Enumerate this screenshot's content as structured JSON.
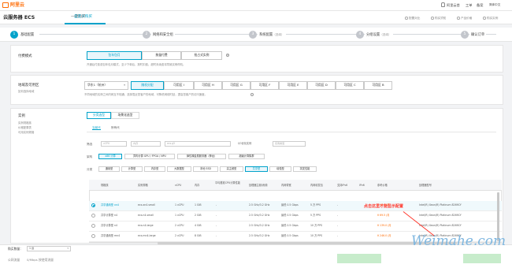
{
  "topbar": {
    "logo_text": "阿里云",
    "home": "阿里云首",
    "work": "工单",
    "filing": "备案",
    "support": "支持与服务",
    "lang": "简体中文"
  },
  "subbar": {
    "product_title": "云服务器 ECS",
    "tabs": [
      "一键购买",
      "自定义购买"
    ],
    "links": [
      "配置对比",
      "购买须知",
      "产品价格",
      "购买实例"
    ]
  },
  "steps": [
    {
      "num": "1",
      "label": "基础配置",
      "note": ""
    },
    {
      "num": "2",
      "label": "网络和安全组",
      "note": ""
    },
    {
      "num": "3",
      "label": "系统配置",
      "note": "（选填）"
    },
    {
      "num": "4",
      "label": "分组设置",
      "note": "（选填）"
    },
    {
      "num": "5",
      "label": "确认订单",
      "note": ""
    }
  ],
  "billing": {
    "title": "付费模式",
    "options": [
      "包年包月",
      "按量付费",
      "抢占式实例"
    ],
    "hint": "?",
    "desc": "开通后付费或包年包月模式，至少下单后，按时扣费。超时未续费将导致实例停机。"
  },
  "region": {
    "title": "地域及可用区",
    "desc": "如何选择地域",
    "region_select": "华东1（杭州）",
    "zones": [
      "随机分配",
      "可用区 I",
      "可用区 H",
      "可用区 G",
      "可用区 F",
      "可用区 E",
      "可用区 D",
      "可用区 C",
      "可用区 B"
    ],
    "note": "不同地域的实例之间内网互不相通，选择靠近您客户的地域，可降低网络时延，提高您客户的访问速度。"
  },
  "instance": {
    "title": "实例",
    "links": [
      "实例规格族",
      "价格配置表",
      "可用实例规格"
    ],
    "tabs": [
      "分类选型",
      "场景化选型"
    ],
    "subtabs": [
      "当前代",
      "所有代"
    ],
    "filter_label": "筛选",
    "filters": [
      "vCPU",
      "内存",
      "ecs.g5",
      "I/O优化实例",
      "实例类型"
    ],
    "arch_label": "架构",
    "arch": [
      "x86 计算",
      "异构计算 GPU / FPGA / NPU",
      "弹性裸金属服务器（神龙）",
      "超级计算集群"
    ],
    "cat_label": "分类",
    "categories": [
      "通用型",
      "计算型",
      "内存型",
      "大数据型",
      "本地 SSD",
      "高主频型",
      "共享型",
      "增强型",
      "突发性能"
    ],
    "headers": [
      "规格族",
      "实例规格",
      "vCPU",
      "内存",
      "平均基准CPU计算性能",
      "处理器主频/睿频",
      "内网带宽",
      "内网收发包",
      "支持IPv6",
      "IPv6",
      "参考价格",
      "处理器型号"
    ],
    "rows": [
      {
        "family": "共享通用型 xn4",
        "spec": "ecs.xn4.small",
        "vcpu": "1 vCPU",
        "mem": "1 GiB",
        "base": "-",
        "freq": "2.5 GHz/3.2 GHz",
        "bw": "最低 0.5 Gbps",
        "pps": "5 万 PPS",
        "v6": "-",
        "price": "¥ 46.8 /月",
        "cpu": "Intel(R) Xeon(R) Platinum 8269CY",
        "selected": true
      },
      {
        "family": "共享计算型 n4",
        "spec": "ecs.n4.small",
        "vcpu": "1 vCPU",
        "mem": "2 GiB",
        "base": "-",
        "freq": "2.5 GHz/3.2 GHz",
        "bw": "最低 0.5 Gbps",
        "pps": "5 万 PPS",
        "v6": "-",
        "price": "¥ 69.5 /月",
        "cpu": "Intel(R) Xeon(R) Platinum 8269CY",
        "selected": false
      },
      {
        "family": "共享计算型 n4",
        "spec": "ecs.n4.large",
        "vcpu": "2 vCPU",
        "mem": "4 GiB",
        "base": "-",
        "freq": "2.5 GHz/3.2 GHz",
        "bw": "最低 0.5 Gbps",
        "pps": "10 万 PPS",
        "v6": "-",
        "price": "¥ 139.0 /月",
        "cpu": "Intel(R) Xeon(R) Platinum 8269CY",
        "selected": false
      },
      {
        "family": "共享通用型 mn4",
        "spec": "ecs.mn4.large",
        "vcpu": "2 vCPU",
        "mem": "8 GiB",
        "base": "-",
        "freq": "2.5 GHz/3.2 GHz",
        "bw": "最低 0.5 Gbps",
        "pps": "10 万 PPS",
        "v6": "-",
        "price": "¥ 246.0 /月",
        "cpu": "Intel(R) Xeon(R) Platinum 8269CY",
        "selected": false
      }
    ]
  },
  "annotation": "点击这里才能显示配置",
  "bottom": {
    "qty_label": "购买数量：",
    "qty_value": "1 台",
    "cost_label": "公网流量",
    "cost_value": "0/Mbps 按使用流量"
  },
  "watermark": "Weimahe.com",
  "colors": {
    "accent": "#00a2ca",
    "brand": "#ff6a00",
    "annotation": "#ff3b30"
  }
}
